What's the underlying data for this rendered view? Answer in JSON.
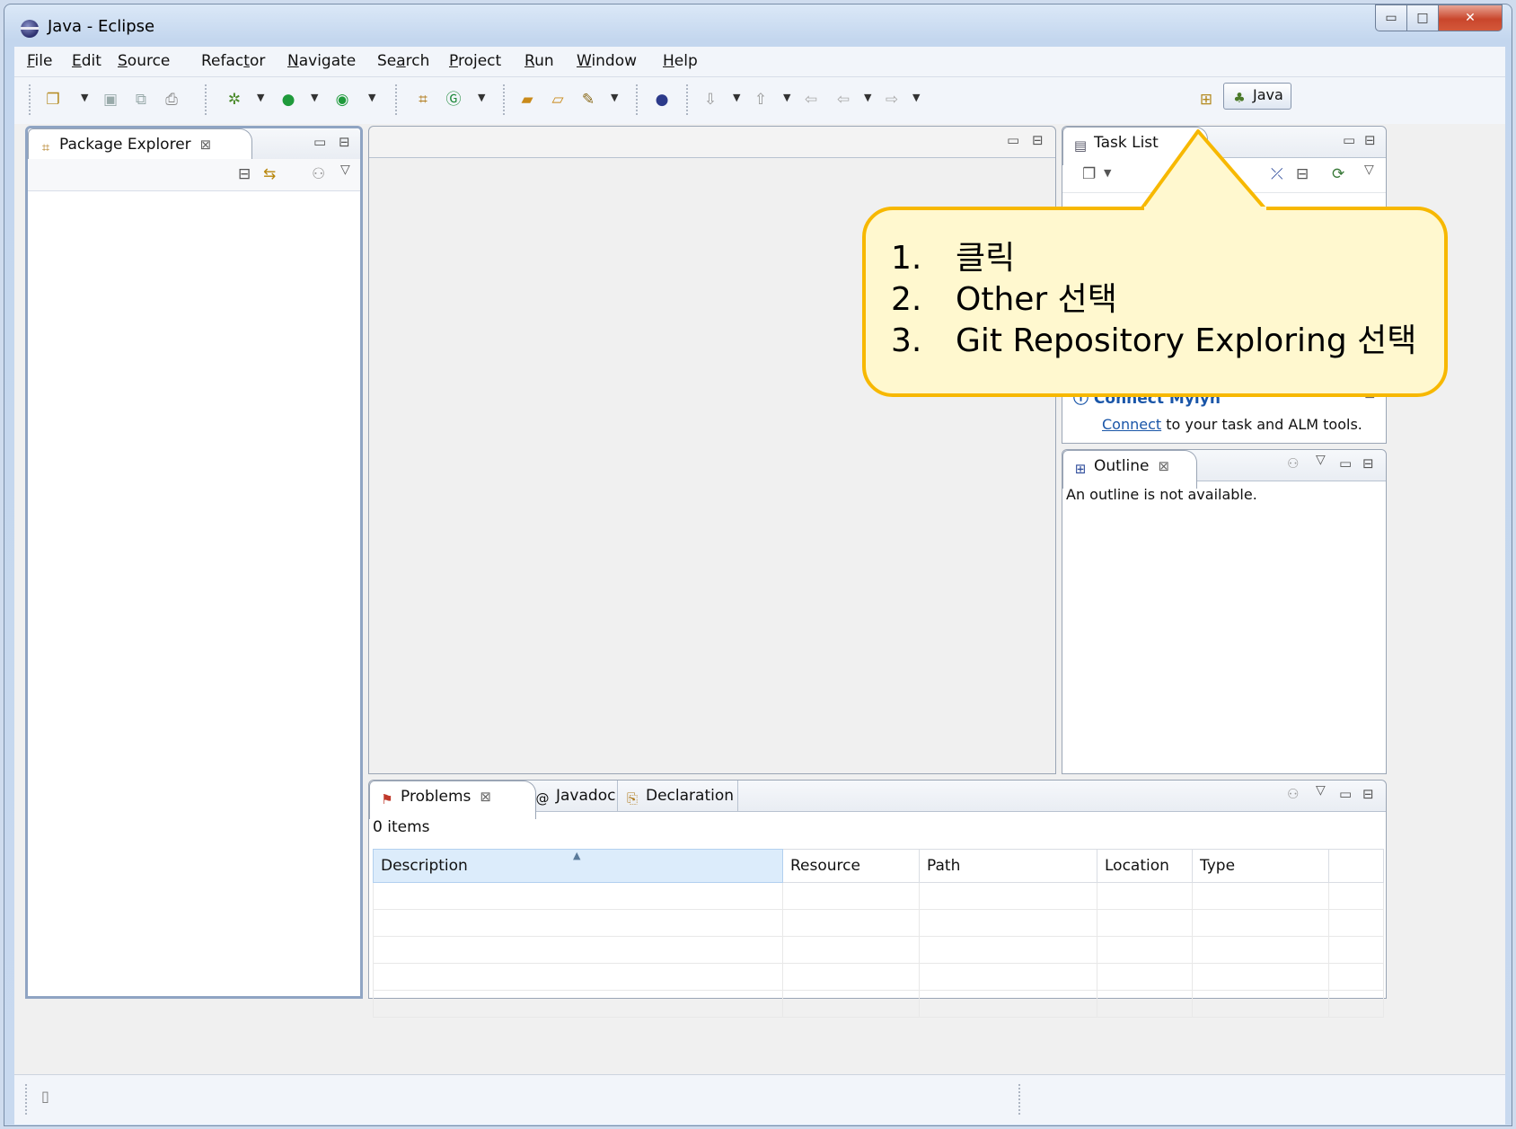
{
  "window": {
    "title": "Java - Eclipse",
    "minimize_glyph": "▭",
    "maximize_glyph": "□",
    "close_glyph": "✕"
  },
  "menu": [
    {
      "label": "File",
      "mnemonic": "F",
      "rest": "ile"
    },
    {
      "label": "Edit",
      "mnemonic": "E",
      "rest": "dit"
    },
    {
      "label": "Source",
      "mnemonic": "S",
      "rest": "ource"
    },
    {
      "label": "Refactor",
      "pre": "Refac",
      "mnemonic": "t",
      "rest": "or"
    },
    {
      "label": "Navigate",
      "mnemonic": "N",
      "rest": "avigate"
    },
    {
      "label": "Search",
      "pre": "Se",
      "mnemonic": "a",
      "rest": "rch"
    },
    {
      "label": "Project",
      "mnemonic": "P",
      "rest": "roject"
    },
    {
      "label": "Run",
      "mnemonic": "R",
      "rest": "un"
    },
    {
      "label": "Window",
      "mnemonic": "W",
      "rest": "indow"
    },
    {
      "label": "Help",
      "mnemonic": "H",
      "rest": "elp"
    }
  ],
  "toolbar": {
    "icons": [
      "new-icon",
      "save-icon",
      "save-all-icon",
      "print-icon",
      "debug-icon",
      "run-icon",
      "external-tools-icon",
      "new-java-package-icon",
      "new-java-class-icon",
      "open-type-icon",
      "open-task-icon",
      "search-icon",
      "web-browser-icon",
      "next-annotation-icon",
      "previous-annotation-icon",
      "last-edit-icon",
      "back-icon",
      "forward-icon"
    ],
    "perspective_label": "Java",
    "open_perspective_icon": "open-perspective-icon"
  },
  "package_explorer": {
    "title": "Package Explorer"
  },
  "task_list": {
    "title": "Task List"
  },
  "mylyn": {
    "title": "Connect Mylyn",
    "link": "Connect",
    "text": " to your task and ALM tools."
  },
  "outline": {
    "title": "Outline",
    "message": "An outline is not available."
  },
  "bottom_tabs": [
    {
      "label": "Problems",
      "icon": "problems-icon",
      "active": true
    },
    {
      "label": "Javadoc",
      "icon": "javadoc-icon",
      "active": false
    },
    {
      "label": "Declaration",
      "icon": "declaration-icon",
      "active": false
    }
  ],
  "problems": {
    "count_text": "0 items",
    "columns": [
      "Description",
      "Resource",
      "Path",
      "Location",
      "Type"
    ],
    "empty_rows": 5
  },
  "colors": {
    "accent": "#f7b800",
    "callout_bg": "#fff8cf",
    "link": "#1a56a8"
  },
  "callout": {
    "items": [
      {
        "num": "1.",
        "text": "클릭"
      },
      {
        "num": "2.",
        "text": "Other 선택"
      },
      {
        "num": "3.",
        "text": "Git Repository Exploring 선택"
      }
    ]
  }
}
